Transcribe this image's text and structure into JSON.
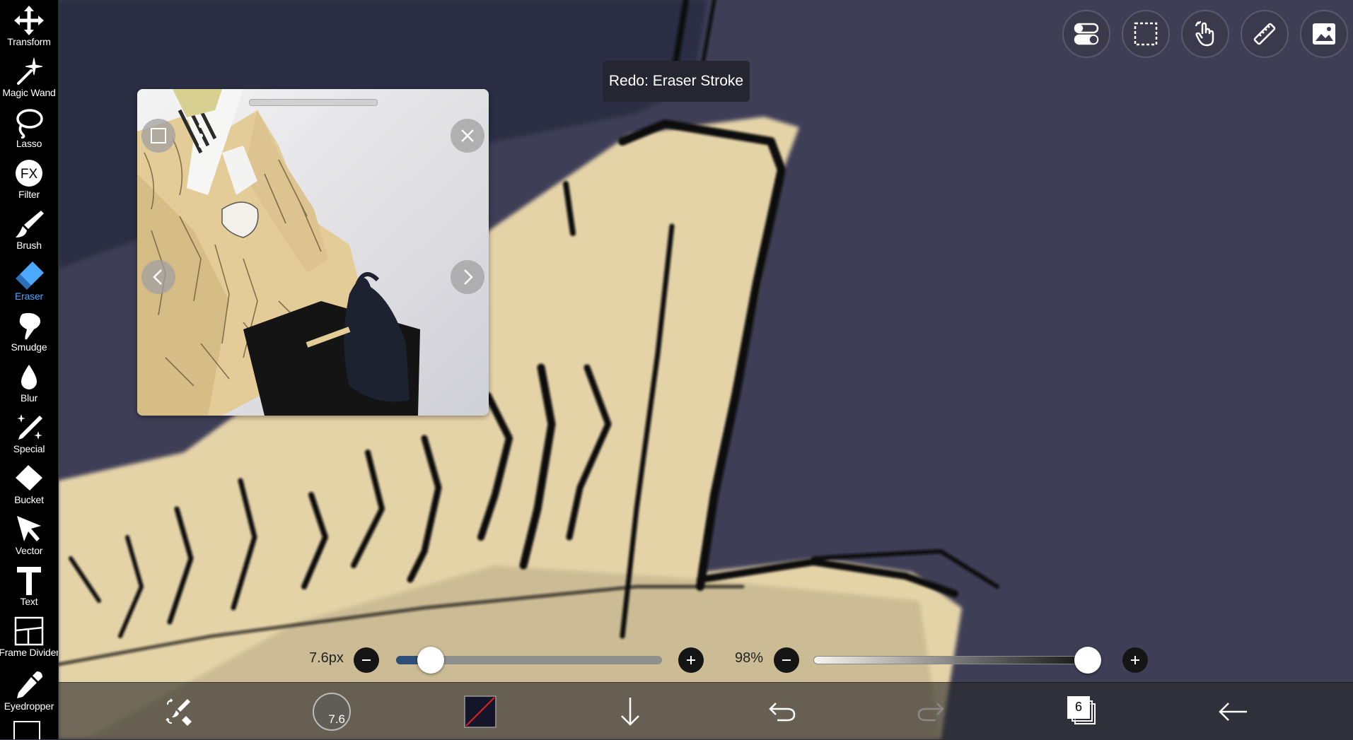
{
  "toolbar": {
    "items": [
      {
        "label": "Transform",
        "icon": "move-arrows-icon",
        "active": false
      },
      {
        "label": "Magic Wand",
        "icon": "magic-wand-icon",
        "active": false
      },
      {
        "label": "Lasso",
        "icon": "lasso-icon",
        "active": false
      },
      {
        "label": "Filter",
        "icon": "fx-icon",
        "active": false
      },
      {
        "label": "Brush",
        "icon": "brush-icon",
        "active": false
      },
      {
        "label": "Eraser",
        "icon": "eraser-icon",
        "active": true
      },
      {
        "label": "Smudge",
        "icon": "smudge-icon",
        "active": false
      },
      {
        "label": "Blur",
        "icon": "droplet-icon",
        "active": false
      },
      {
        "label": "Special",
        "icon": "sparkle-pen-icon",
        "active": false
      },
      {
        "label": "Bucket",
        "icon": "bucket-icon",
        "active": false
      },
      {
        "label": "Vector",
        "icon": "cursor-arrow-icon",
        "active": false
      },
      {
        "label": "Text",
        "icon": "text-t-icon",
        "active": false
      },
      {
        "label": "Frame Divider",
        "icon": "frame-divider-icon",
        "active": false
      },
      {
        "label": "Eyedropper",
        "icon": "eyedropper-icon",
        "active": false
      }
    ],
    "active_color": "#4aa8ff"
  },
  "top_buttons": [
    "toggle-icon",
    "selection-rect-icon",
    "hand-gesture-icon",
    "ruler-icon",
    "image-icon"
  ],
  "tooltip": {
    "text": "Redo: Eraser Stroke"
  },
  "reference_window": {
    "buttons": [
      "fullscreen-icon",
      "more-vertical-icon",
      "close-icon",
      "prev-icon",
      "next-icon"
    ]
  },
  "brush_size": {
    "value_label": "7.6px",
    "fraction": 0.13
  },
  "opacity": {
    "value_label": "98%",
    "fraction": 0.98
  },
  "bottom_bar": {
    "brush_size_badge": "7.6",
    "layer_count": "6",
    "primary_color": "#15152a",
    "items": [
      "brush-eraser-switch-icon",
      "brush-size-icon",
      "color-swatch",
      "download-arrow-icon",
      "undo-icon",
      "redo-icon",
      "layers-icon",
      "back-arrow-icon"
    ]
  },
  "colors": {
    "canvas_bg": "#3f3f59",
    "paper": "#e9d8b0",
    "ink": "#111111",
    "accent": "#4aa8ff"
  }
}
